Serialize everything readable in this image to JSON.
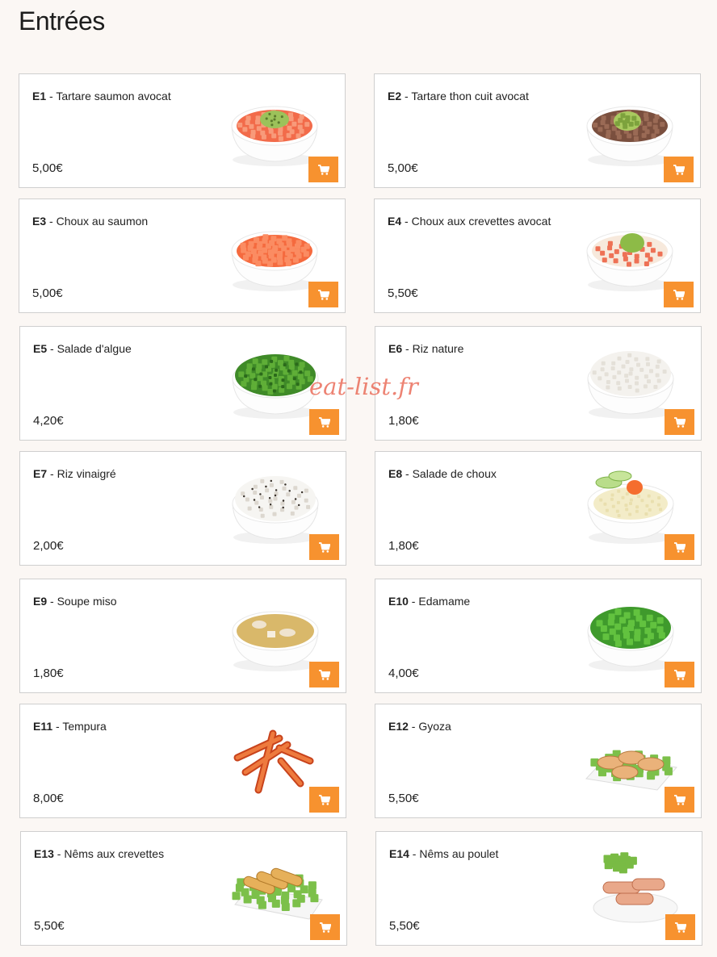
{
  "section": {
    "title": "Entrées"
  },
  "watermark": "eat-list.fr",
  "accent_color": "#f7922f",
  "items": [
    {
      "code": "E1",
      "sep": " - ",
      "name": "Tartare saumon avocat",
      "price": "5,00€",
      "image": "salmon-avocado-bowl"
    },
    {
      "code": "E2",
      "sep": " - ",
      "name": "Tartare thon cuit avocat",
      "price": "5,00€",
      "image": "tuna-avocado-bowl"
    },
    {
      "code": "E3",
      "sep": " - ",
      "name": "Choux au saumon",
      "price": "5,00€",
      "image": "salmon-cabbage-bowl"
    },
    {
      "code": "E4",
      "sep": " - ",
      "name": "Choux aux crevettes avocat",
      "price": "5,50€",
      "image": "shrimp-avocado-bowl"
    },
    {
      "code": "E5",
      "sep": " - ",
      "name": "Salade d'algue",
      "price": "4,20€",
      "image": "seaweed-salad-bowl"
    },
    {
      "code": "E6",
      "sep": " - ",
      "name": "Riz nature",
      "price": "1,80€",
      "image": "plain-rice-bowl"
    },
    {
      "code": "E7",
      "sep": " - ",
      "name": "Riz vinaigré",
      "price": "2,00€",
      "image": "sesame-rice-bowl"
    },
    {
      "code": "E8",
      "sep": " - ",
      "name": "Salade de choux",
      "price": "1,80€",
      "image": "cabbage-salad-bowl"
    },
    {
      "code": "E9",
      "sep": " - ",
      "name": "Soupe miso",
      "price": "1,80€",
      "image": "miso-soup-bowl"
    },
    {
      "code": "E10",
      "sep": " - ",
      "name": "Edamame",
      "price": "4,00€",
      "image": "edamame-bowl"
    },
    {
      "code": "E11",
      "sep": " - ",
      "name": "Tempura",
      "price": "8,00€",
      "image": "tempura-shrimp"
    },
    {
      "code": "E12",
      "sep": " - ",
      "name": "Gyoza",
      "price": "5,50€",
      "image": "gyoza-plate"
    },
    {
      "code": "E13",
      "sep": " - ",
      "name": "Nêms aux crevettes",
      "price": "5,50€",
      "image": "shrimp-nems"
    },
    {
      "code": "E14",
      "sep": " - ",
      "name": "Nêms au poulet",
      "price": "5,50€",
      "image": "chicken-nems"
    }
  ]
}
